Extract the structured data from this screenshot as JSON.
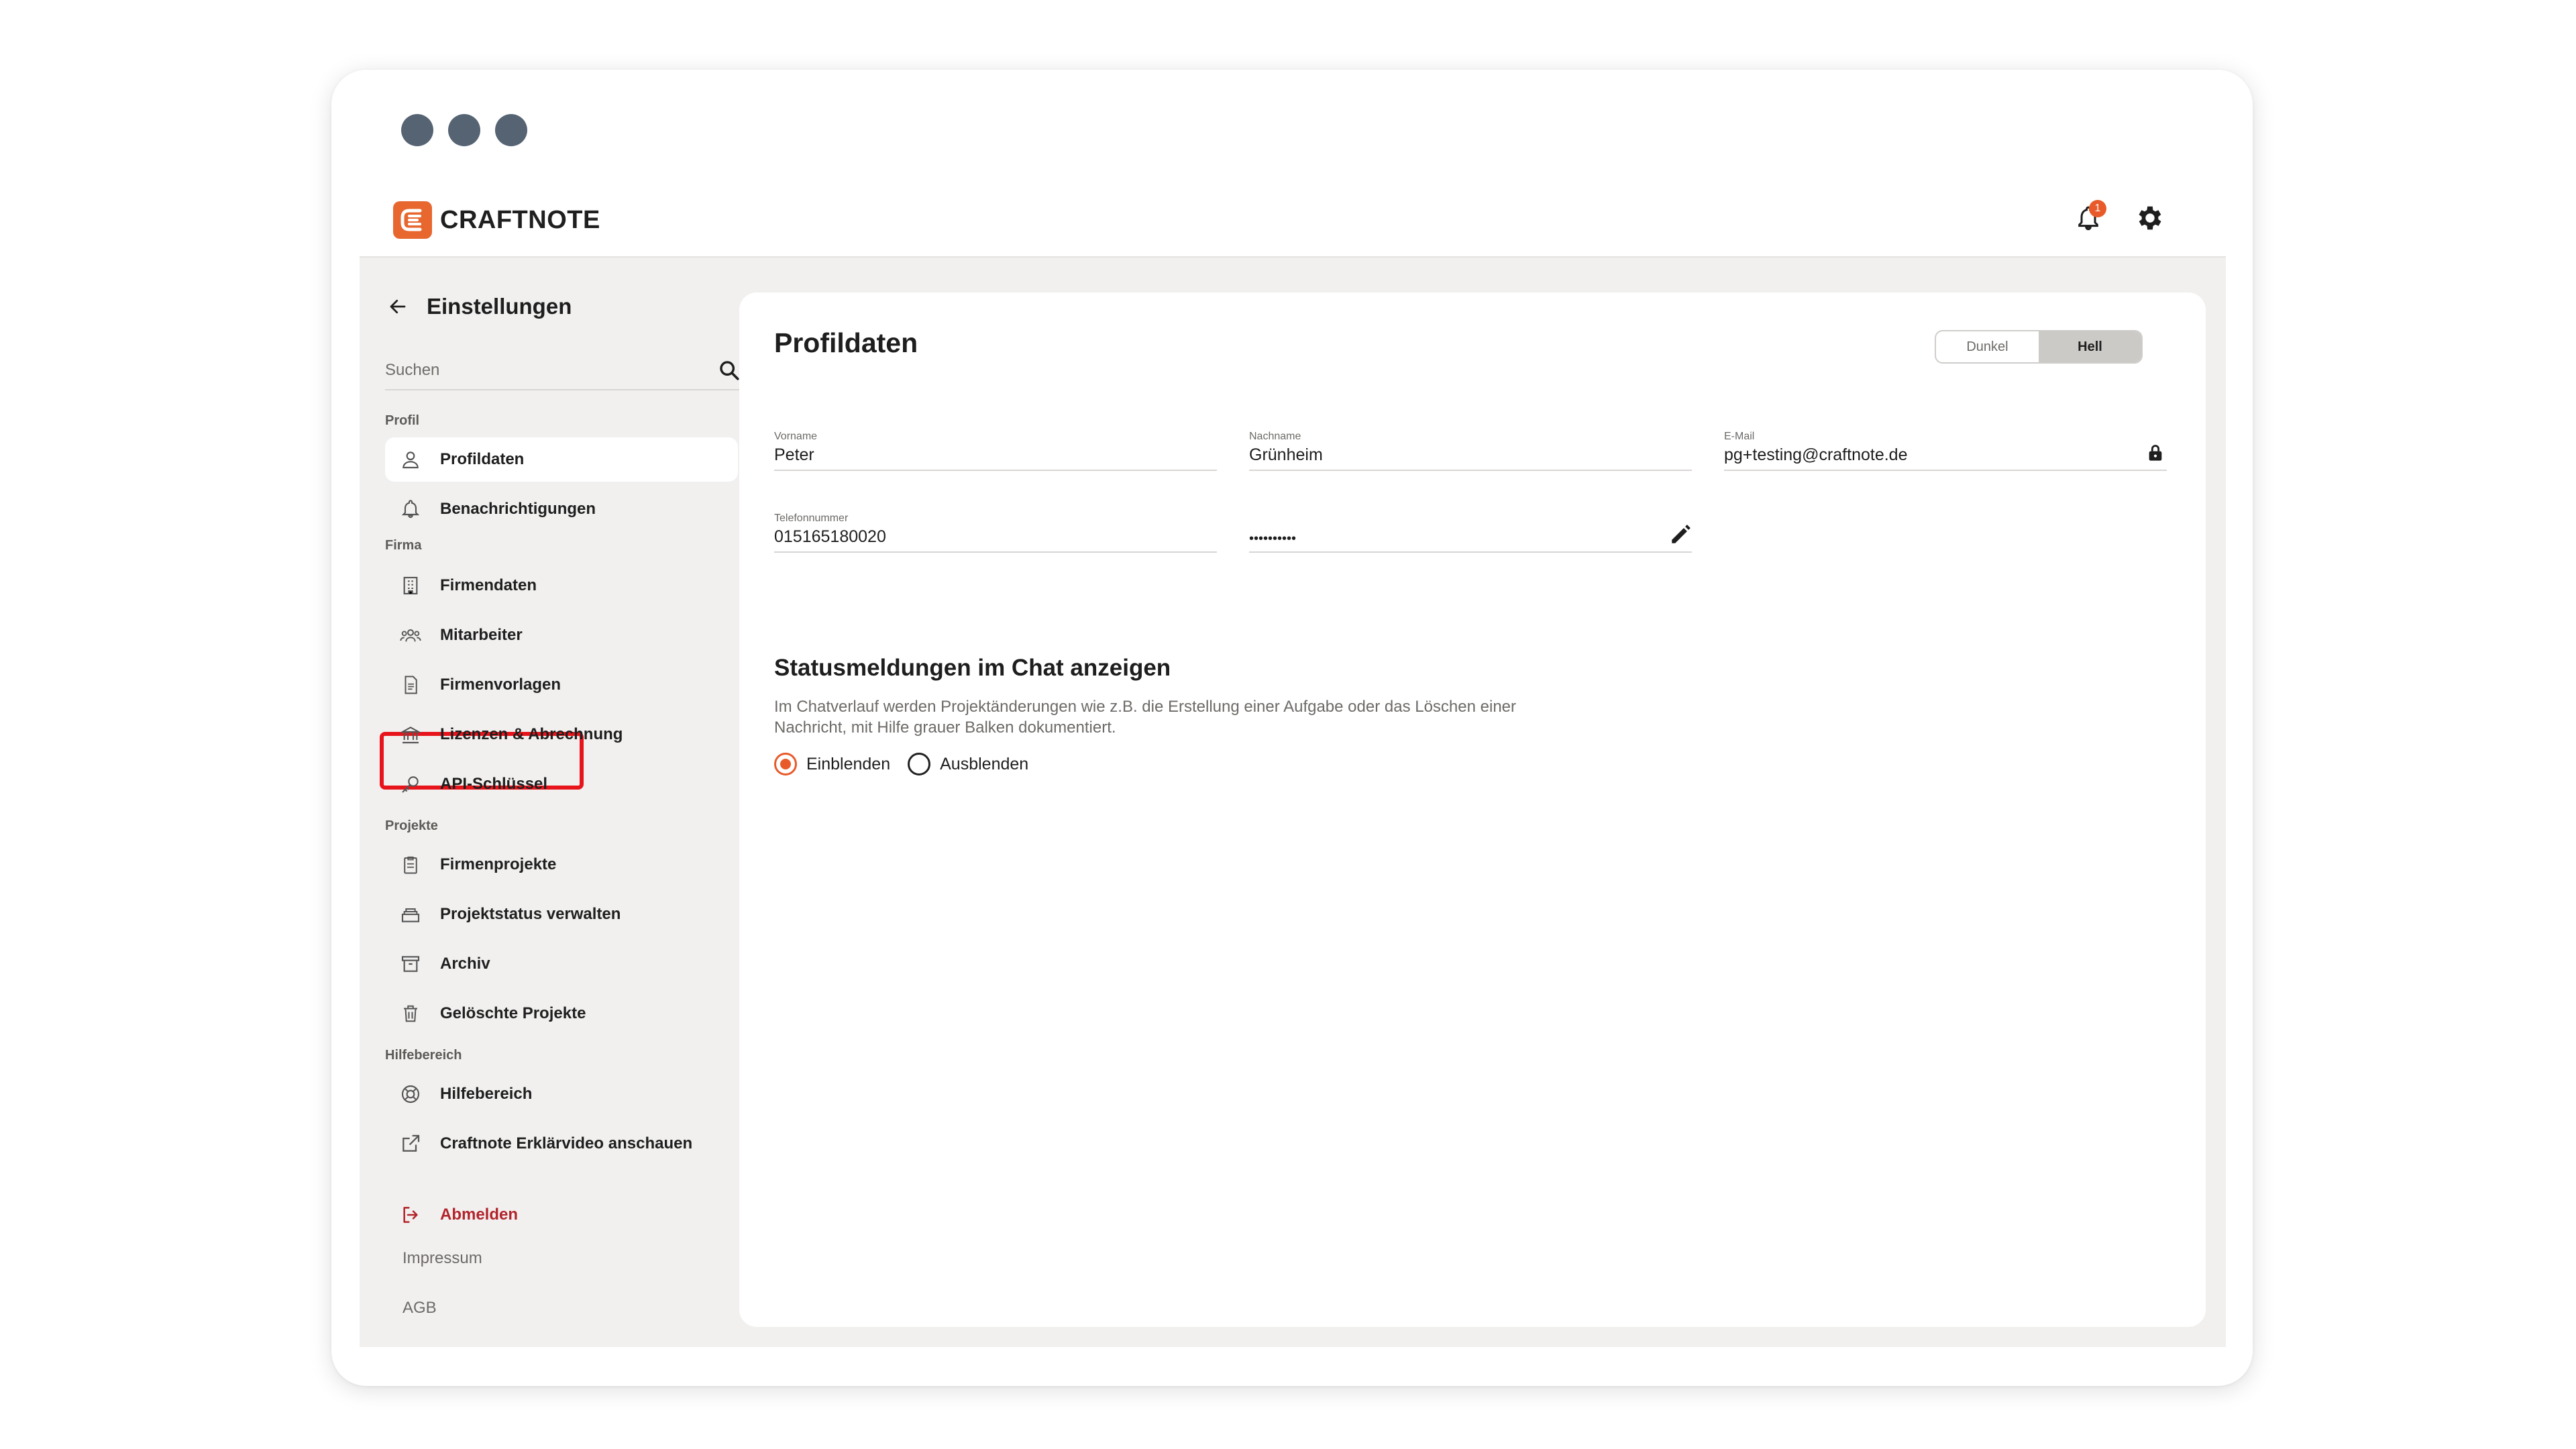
{
  "app": {
    "brand": "CRAFTNOTE",
    "notification_count": "1",
    "accent_color": "#e85a2a",
    "danger_color": "#b3242b",
    "highlight_color": "#e8141b"
  },
  "window": {
    "controls": [
      "circle-dot",
      "circle-dot",
      "circle-dot"
    ]
  },
  "topbar": {
    "icons": [
      "bell-icon",
      "gear-icon"
    ]
  },
  "sidebar": {
    "title": "Einstellungen",
    "search": {
      "placeholder": "Suchen",
      "value": ""
    },
    "sections": {
      "profil": "Profil",
      "firma": "Firma",
      "projekte": "Projekte",
      "hilfe": "Hilfebereich"
    },
    "items": {
      "profildaten": "Profildaten",
      "benachrichtigungen": "Benachrichtigungen",
      "firmendaten": "Firmendaten",
      "mitarbeiter": "Mitarbeiter",
      "firmenvorlagen": "Firmenvorlagen",
      "lizenzen": "Lizenzen & Abrechnung",
      "api": "API-Schlüssel",
      "firmenprojekte": "Firmenprojekte",
      "projektstatus": "Projektstatus verwalten",
      "archiv": "Archiv",
      "geloeschte": "Gelöschte Projekte",
      "hilfebereich": "Hilfebereich",
      "video": "Craftnote Erklärvideo anschauen"
    },
    "active_item": "Profildaten",
    "highlighted_item": "Firmenvorlagen",
    "logout": "Abmelden",
    "footer": {
      "impressum": "Impressum",
      "agb": "AGB"
    }
  },
  "main": {
    "title": "Profildaten",
    "theme": {
      "dark": "Dunkel",
      "light": "Hell",
      "selected": "Hell"
    },
    "fields": {
      "vorname": {
        "label": "Vorname",
        "value": "Peter"
      },
      "nachname": {
        "label": "Nachname",
        "value": "Grünheim"
      },
      "email": {
        "label": "E-Mail",
        "value": "pg+testing@craftnote.de"
      },
      "telefon": {
        "label": "Telefonnummer",
        "value": "015165180020"
      },
      "passwort": {
        "label": "",
        "value": "••••••••••"
      }
    },
    "status": {
      "title": "Statusmeldungen im Chat anzeigen",
      "description": "Im Chatverlauf werden Projektänderungen wie z.B. die Erstellung einer Aufgabe oder das Löschen einer Nachricht, mit Hilfe grauer Balken dokumentiert.",
      "options": {
        "show": "Einblenden",
        "hide": "Ausblenden"
      },
      "selected": "Einblenden"
    }
  }
}
